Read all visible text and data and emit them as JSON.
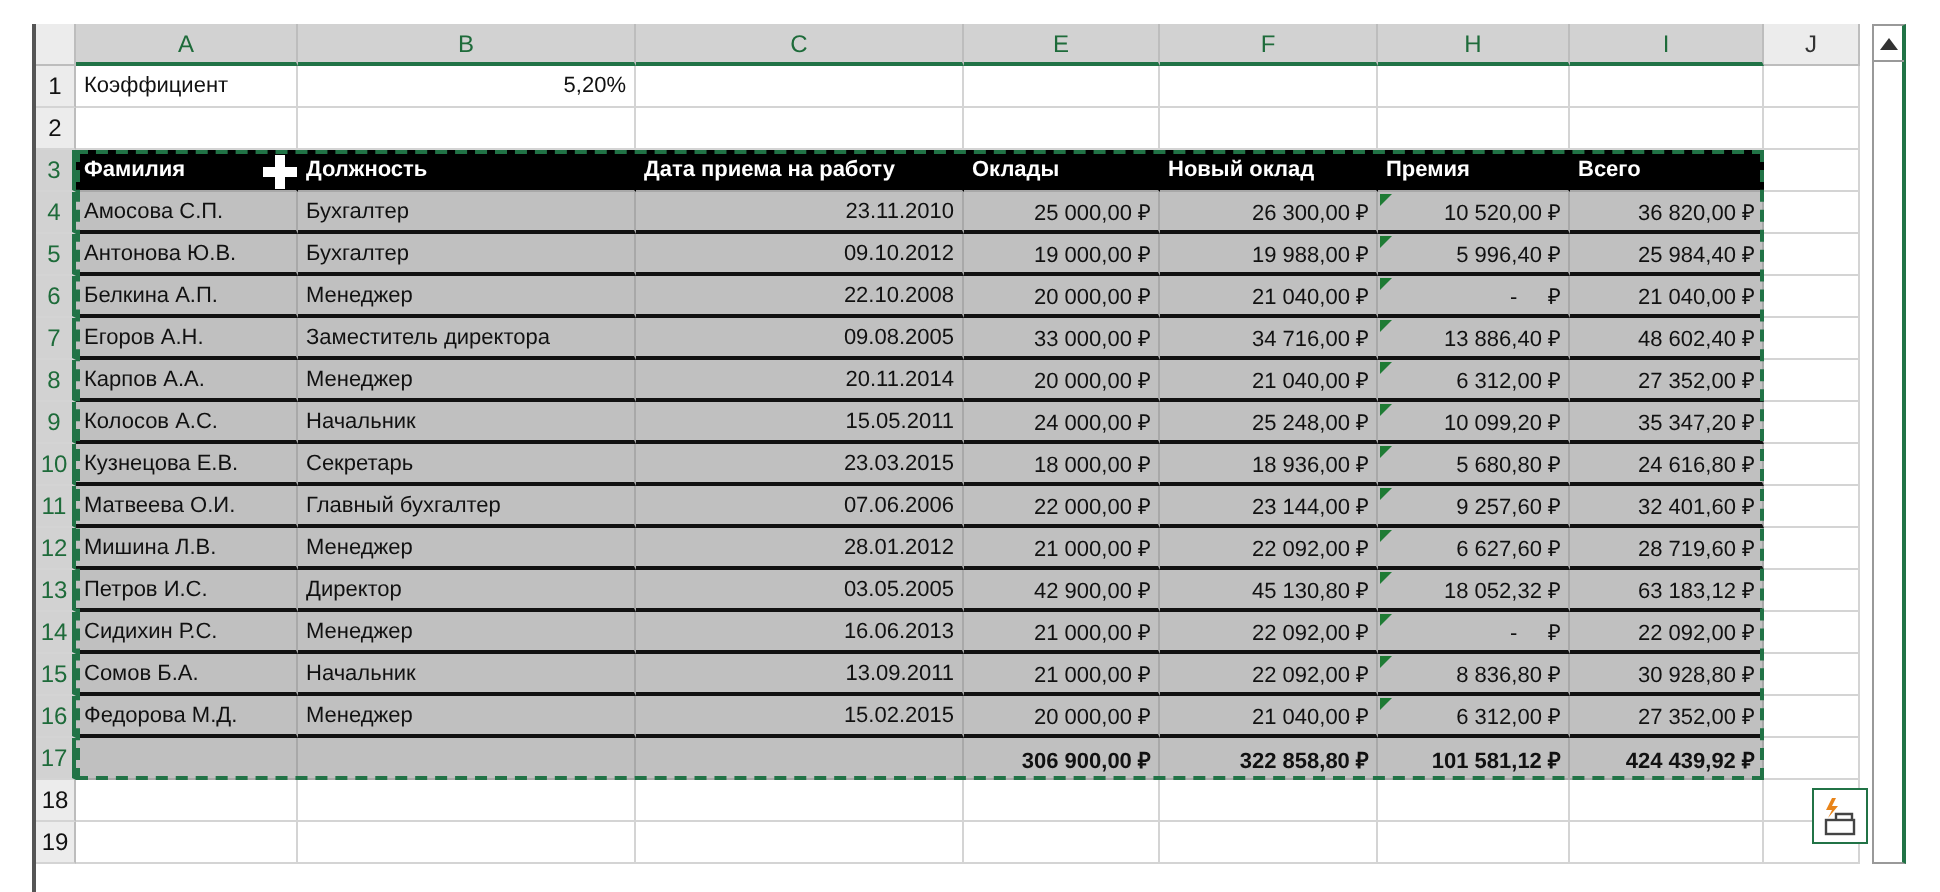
{
  "columns": [
    {
      "label": "A",
      "selected": true
    },
    {
      "label": "B",
      "selected": true
    },
    {
      "label": "C",
      "selected": true
    },
    {
      "label": "E",
      "selected": true
    },
    {
      "label": "F",
      "selected": true
    },
    {
      "label": "H",
      "selected": true
    },
    {
      "label": "I",
      "selected": true
    },
    {
      "label": "J",
      "selected": false
    }
  ],
  "rows": [
    {
      "number": "1",
      "selected": false,
      "kind": "plain",
      "a": "Коэффициент",
      "b": "5,20%"
    },
    {
      "number": "2",
      "selected": false,
      "kind": "plain"
    },
    {
      "number": "3",
      "selected": true,
      "kind": "header",
      "cells": [
        "Фамилия",
        "Должность",
        "Дата приема на работу",
        "Оклады",
        "Новый оклад",
        "Премия",
        "Всего"
      ]
    },
    {
      "number": "4",
      "selected": true,
      "kind": "data",
      "flagged": true,
      "cells": [
        "Амосова С.П.",
        "Бухгалтер",
        "23.11.2010",
        "25 000,00 ₽",
        "26 300,00 ₽",
        "10 520,00 ₽",
        "36 820,00 ₽"
      ]
    },
    {
      "number": "5",
      "selected": true,
      "kind": "data",
      "flagged": true,
      "cells": [
        "Антонова Ю.В.",
        "Бухгалтер",
        "09.10.2012",
        "19 000,00 ₽",
        "19 988,00 ₽",
        "5 996,40 ₽",
        "25 984,40 ₽"
      ]
    },
    {
      "number": "6",
      "selected": true,
      "kind": "data",
      "flagged": true,
      "cells": [
        "Белкина А.П.",
        "Менеджер",
        "22.10.2008",
        "20 000,00 ₽",
        "21 040,00 ₽",
        "-     ₽",
        "21 040,00 ₽"
      ]
    },
    {
      "number": "7",
      "selected": true,
      "kind": "data",
      "flagged": true,
      "cells": [
        "Егоров А.Н.",
        "Заместитель директора",
        "09.08.2005",
        "33 000,00 ₽",
        "34 716,00 ₽",
        "13 886,40 ₽",
        "48 602,40 ₽"
      ]
    },
    {
      "number": "8",
      "selected": true,
      "kind": "data",
      "flagged": true,
      "cells": [
        "Карпов А.А.",
        "Менеджер",
        "20.11.2014",
        "20 000,00 ₽",
        "21 040,00 ₽",
        "6 312,00 ₽",
        "27 352,00 ₽"
      ]
    },
    {
      "number": "9",
      "selected": true,
      "kind": "data",
      "flagged": true,
      "cells": [
        "Колосов А.С.",
        "Начальник",
        "15.05.2011",
        "24 000,00 ₽",
        "25 248,00 ₽",
        "10 099,20 ₽",
        "35 347,20 ₽"
      ]
    },
    {
      "number": "10",
      "selected": true,
      "kind": "data",
      "flagged": true,
      "cells": [
        "Кузнецова Е.В.",
        "Секретарь",
        "23.03.2015",
        "18 000,00 ₽",
        "18 936,00 ₽",
        "5 680,80 ₽",
        "24 616,80 ₽"
      ]
    },
    {
      "number": "11",
      "selected": true,
      "kind": "data",
      "flagged": true,
      "cells": [
        "Матвеева О.И.",
        "Главный бухгалтер",
        "07.06.2006",
        "22 000,00 ₽",
        "23 144,00 ₽",
        "9 257,60 ₽",
        "32 401,60 ₽"
      ]
    },
    {
      "number": "12",
      "selected": true,
      "kind": "data",
      "flagged": true,
      "cells": [
        "Мишина Л.В.",
        "Менеджер",
        "28.01.2012",
        "21 000,00 ₽",
        "22 092,00 ₽",
        "6 627,60 ₽",
        "28 719,60 ₽"
      ]
    },
    {
      "number": "13",
      "selected": true,
      "kind": "data",
      "flagged": true,
      "cells": [
        "Петров И.С.",
        "Директор",
        "03.05.2005",
        "42 900,00 ₽",
        "45 130,80 ₽",
        "18 052,32 ₽",
        "63 183,12 ₽"
      ]
    },
    {
      "number": "14",
      "selected": true,
      "kind": "data",
      "flagged": true,
      "cells": [
        "Сидихин Р.С.",
        "Менеджер",
        "16.06.2013",
        "21 000,00 ₽",
        "22 092,00 ₽",
        "-     ₽",
        "22 092,00 ₽"
      ]
    },
    {
      "number": "15",
      "selected": true,
      "kind": "data",
      "flagged": true,
      "cells": [
        "Сомов Б.А.",
        "Начальник",
        "13.09.2011",
        "21 000,00 ₽",
        "22 092,00 ₽",
        "8 836,80 ₽",
        "30 928,80 ₽"
      ]
    },
    {
      "number": "16",
      "selected": true,
      "kind": "data",
      "flagged": true,
      "cells": [
        "Федорова М.Д.",
        "Менеджер",
        "15.02.2015",
        "20 000,00 ₽",
        "21 040,00 ₽",
        "6 312,00 ₽",
        "27 352,00 ₽"
      ]
    },
    {
      "number": "17",
      "selected": true,
      "kind": "total",
      "totals": [
        "306 900,00 ₽",
        "322 858,80 ₽",
        "101 581,12 ₽",
        "424 439,92 ₽"
      ]
    },
    {
      "number": "18",
      "selected": false,
      "kind": "plain"
    },
    {
      "number": "19",
      "selected": false,
      "kind": "plain"
    }
  ]
}
